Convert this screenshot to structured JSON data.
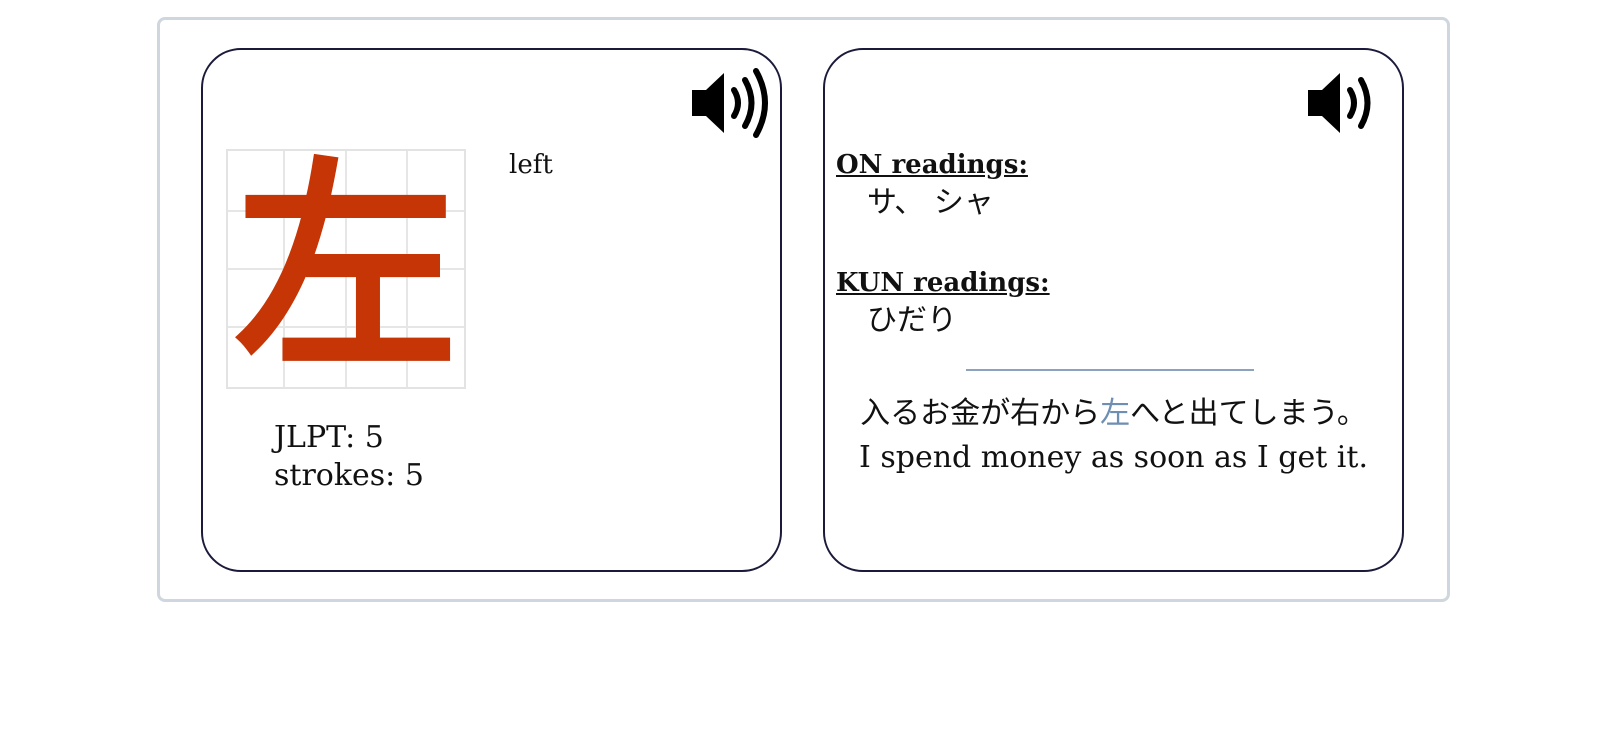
{
  "kanji": {
    "character": "左",
    "meaning": "left",
    "jlpt_label": "JLPT: 5",
    "strokes_label": "strokes: 5",
    "color": "#c53505"
  },
  "readings": {
    "on_heading": "ON readings:",
    "on_values": "サ、 シャ",
    "kun_heading": "KUN readings:",
    "kun_values": "ひだり"
  },
  "example": {
    "jp_before": "入るお金が右から",
    "jp_highlight": "左",
    "jp_after": "へと出てしまう。",
    "en": "I spend money as soon as I get it.",
    "highlight_color": "#6e8eb2"
  },
  "icons": {
    "audio_left": "speaker-icon",
    "audio_right": "speaker-icon"
  }
}
